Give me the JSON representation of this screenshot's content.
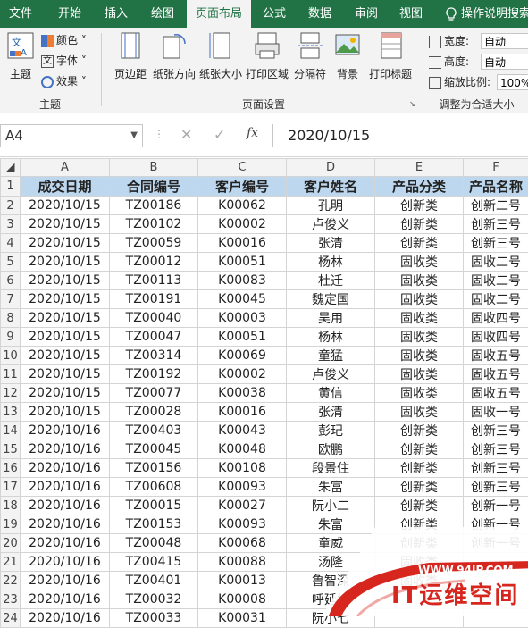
{
  "tabs": [
    "文件",
    "开始",
    "插入",
    "绘图",
    "页面布局",
    "公式",
    "数据",
    "审阅",
    "视图",
    "操作说明搜索"
  ],
  "active_tab": "页面布局",
  "ribbon": {
    "theme": {
      "main": "主题",
      "colors": "颜色",
      "fonts": "字体",
      "effects": "效果",
      "group": "主题"
    },
    "page_setup": {
      "margins": "页边距",
      "orientation": "纸张方向",
      "size": "纸张大小",
      "print_area": "打印区域",
      "breaks": "分隔符",
      "background": "背景",
      "print_titles": "打印标题",
      "group": "页面设置"
    },
    "scale": {
      "width_label": "宽度:",
      "width_value": "自动",
      "height_label": "高度:",
      "height_value": "自动",
      "scale_label": "缩放比例:",
      "scale_value": "100%",
      "group": "调整为合适大小"
    }
  },
  "formula_bar": {
    "name_box": "A4",
    "fx": "fx",
    "value": "2020/10/15"
  },
  "columns": [
    "A",
    "B",
    "C",
    "D",
    "E",
    "F"
  ],
  "headers": [
    "成交日期",
    "合同编号",
    "客户编号",
    "客户姓名",
    "产品分类",
    "产品名称"
  ],
  "rows": [
    [
      "2020/10/15",
      "TZ00186",
      "K00062",
      "孔明",
      "创新类",
      "创新二号"
    ],
    [
      "2020/10/15",
      "TZ00102",
      "K00002",
      "卢俊义",
      "创新类",
      "创新三号"
    ],
    [
      "2020/10/15",
      "TZ00059",
      "K00016",
      "张清",
      "创新类",
      "创新三号"
    ],
    [
      "2020/10/15",
      "TZ00012",
      "K00051",
      "杨林",
      "固收类",
      "固收二号"
    ],
    [
      "2020/10/15",
      "TZ00113",
      "K00083",
      "杜迁",
      "固收类",
      "固收二号"
    ],
    [
      "2020/10/15",
      "TZ00191",
      "K00045",
      "魏定国",
      "固收类",
      "固收二号"
    ],
    [
      "2020/10/15",
      "TZ00040",
      "K00003",
      "吴用",
      "固收类",
      "固收四号"
    ],
    [
      "2020/10/15",
      "TZ00047",
      "K00051",
      "杨林",
      "固收类",
      "固收四号"
    ],
    [
      "2020/10/15",
      "TZ00314",
      "K00069",
      "童猛",
      "固收类",
      "固收五号"
    ],
    [
      "2020/10/15",
      "TZ00192",
      "K00002",
      "卢俊义",
      "固收类",
      "固收五号"
    ],
    [
      "2020/10/15",
      "TZ00077",
      "K00038",
      "黄信",
      "固收类",
      "固收五号"
    ],
    [
      "2020/10/15",
      "TZ00028",
      "K00016",
      "张清",
      "固收类",
      "固收一号"
    ],
    [
      "2020/10/16",
      "TZ00403",
      "K00043",
      "彭玘",
      "创新类",
      "创新三号"
    ],
    [
      "2020/10/16",
      "TZ00045",
      "K00048",
      "欧鹏",
      "创新类",
      "创新三号"
    ],
    [
      "2020/10/16",
      "TZ00156",
      "K00108",
      "段景住",
      "创新类",
      "创新三号"
    ],
    [
      "2020/10/16",
      "TZ00608",
      "K00093",
      "朱富",
      "创新类",
      "创新三号"
    ],
    [
      "2020/10/16",
      "TZ00015",
      "K00027",
      "阮小二",
      "创新类",
      "创新一号"
    ],
    [
      "2020/10/16",
      "TZ00153",
      "K00093",
      "朱富",
      "创新类",
      "创新一号"
    ],
    [
      "2020/10/16",
      "TZ00048",
      "K00068",
      "童威",
      "创新类",
      "创新一号"
    ],
    [
      "2020/10/16",
      "TZ00415",
      "K00088",
      "汤隆",
      "固收类",
      ""
    ],
    [
      "2020/10/16",
      "TZ00401",
      "K00013",
      "鲁智深",
      "固收类",
      ""
    ],
    [
      "2020/10/16",
      "TZ00032",
      "K00008",
      "呼延灼",
      "",
      ""
    ],
    [
      "2020/10/16",
      "TZ00033",
      "K00031",
      "阮小七",
      "",
      ""
    ]
  ],
  "watermark": {
    "url": "WWW.94IP.COM",
    "text": "IT运维空间"
  },
  "colors": {
    "brand": "#217346",
    "header_fill": "#bdd7ee",
    "watermark_red": "#d7261e"
  }
}
